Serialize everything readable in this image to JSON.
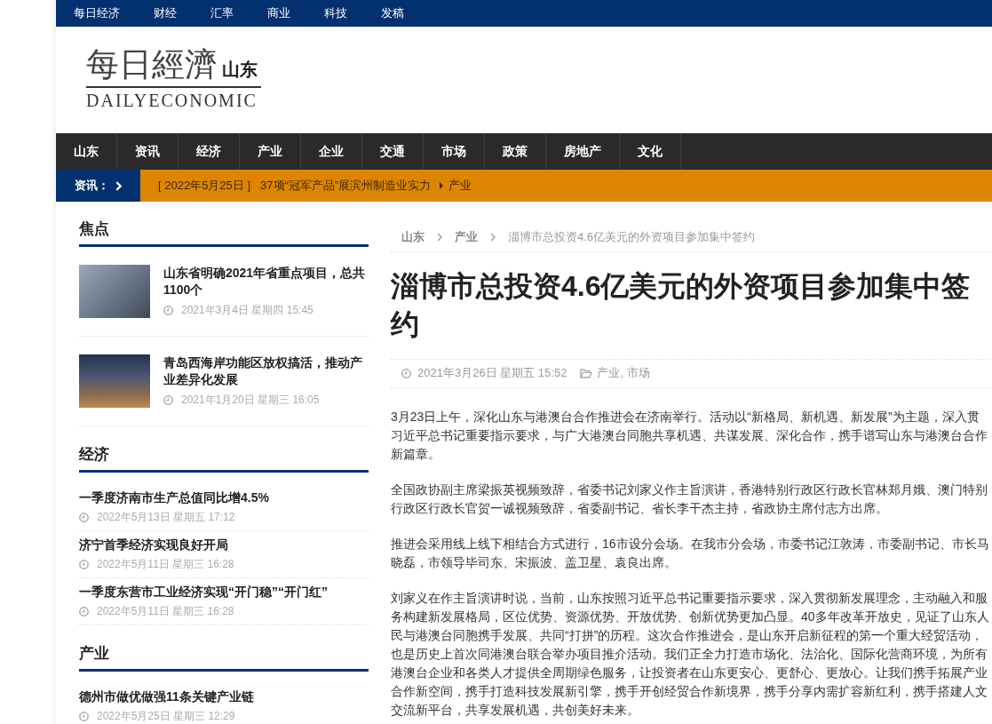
{
  "top_bar": {
    "links": [
      "每日经济",
      "财经",
      "汇率",
      "商业",
      "科技",
      "发稿"
    ]
  },
  "logo": {
    "wordmark": "每日經濟",
    "region": "山东",
    "subtitle": "DAILYECONOMIC"
  },
  "main_nav": {
    "items": [
      "山东",
      "资讯",
      "经济",
      "产业",
      "企业",
      "交通",
      "市场",
      "政策",
      "房地产",
      "文化"
    ]
  },
  "ticker": {
    "label": "资讯：",
    "date": "[ 2022年5月25日 ]",
    "headline": "37项“冠军产品”展滨州制造业实力",
    "category": "产业"
  },
  "sidebar": {
    "sections": [
      {
        "title": "焦点",
        "kind": "thumbnail",
        "items": [
          {
            "title": "山东省明确2021年省重点项目，总共1100个",
            "date": "2021年3月4日 星期四 15:45"
          },
          {
            "title": "青岛西海岸功能区放权搞活，推动产业差异化发展",
            "date": "2021年1月20日 星期三 16:05"
          }
        ]
      },
      {
        "title": "经济",
        "kind": "list",
        "items": [
          {
            "title": "一季度济南市生产总值同比增4.5%",
            "date": "2022年5月13日 星期五 17:12"
          },
          {
            "title": "济宁首季经济实现良好开局",
            "date": "2022年5月11日 星期三 16:28"
          },
          {
            "title": "一季度东营市工业经济实现“开门稳”“开门红”",
            "date": "2022年5月11日 星期三 16:28"
          }
        ]
      },
      {
        "title": "产业",
        "kind": "list",
        "items": [
          {
            "title": "德州市做优做强11条关键产业链",
            "date": "2022年5月25日 星期三 12:29"
          }
        ]
      }
    ]
  },
  "article": {
    "breadcrumb": [
      {
        "label": "山东",
        "current": false
      },
      {
        "label": "产业",
        "current": false
      },
      {
        "label": "淄博市总投资4.6亿美元的外资项目参加集中签约",
        "current": true
      }
    ],
    "title": "淄博市总投资4.6亿美元的外资项目参加集中签约",
    "date": "2021年3月26日 星期五 15:52",
    "categories": "产业, 市场",
    "paragraphs": [
      {
        "lines": [
          "3月23日上午，深化山东与港澳台合作推进会在济南举行。活动以“新格局、新机遇、新发展”为主题，深入贯",
          "习近平总书记重要指示要求，与广大港澳台同胞共享机遇、共谋发展、深化合作，携手谱写山东与港澳台合作",
          "新篇章。"
        ]
      },
      {
        "lines": [
          "全国政协副主席梁振英视频致辞，省委书记刘家义作主旨演讲，香港特别行政区行政长官林郑月娥、澳门特别",
          "行政区行政长官贺一诚视频致辞，省委副书记、省长李干杰主持，省政协主席付志方出席。"
        ]
      },
      {
        "lines": [
          "推进会采用线上线下相结合方式进行，16市设分会场。在我市分会场，市委书记江敦涛，市委副书记、市长马",
          "晓磊，市领导毕司东、宋振波、盖卫星、袁良出席。"
        ]
      },
      {
        "lines": [
          "刘家义在作主旨演讲时说，当前，山东按照习近平总书记重要指示要求，深入贯彻新发展理念，主动融入和服",
          "务构建新发展格局，区位优势、资源优势、开放优势、创新优势更加凸显。40多年改革开放史，见证了山东人",
          "民与港澳台同胞携手发展、共同“打拼”的历程。这次合作推进会，是山东开启新征程的第一个重大经贸活动，",
          "也是历史上首次同港澳台联合举办项目推介活动。我们正全力打造市场化、法治化、国际化营商环境，为所有",
          "港澳台企业和各类人才提供全周期绿色服务，让投资者在山东更安心、更舒心、更放心。让我们携手拓展产业",
          "合作新空间，携手打造科技发展新引擎，携手开创经贸合作新境界，携手分享内需扩容新红利，携手搭建人文",
          "交流新平台，共享发展机遇，共创美好未来。"
        ]
      }
    ]
  }
}
